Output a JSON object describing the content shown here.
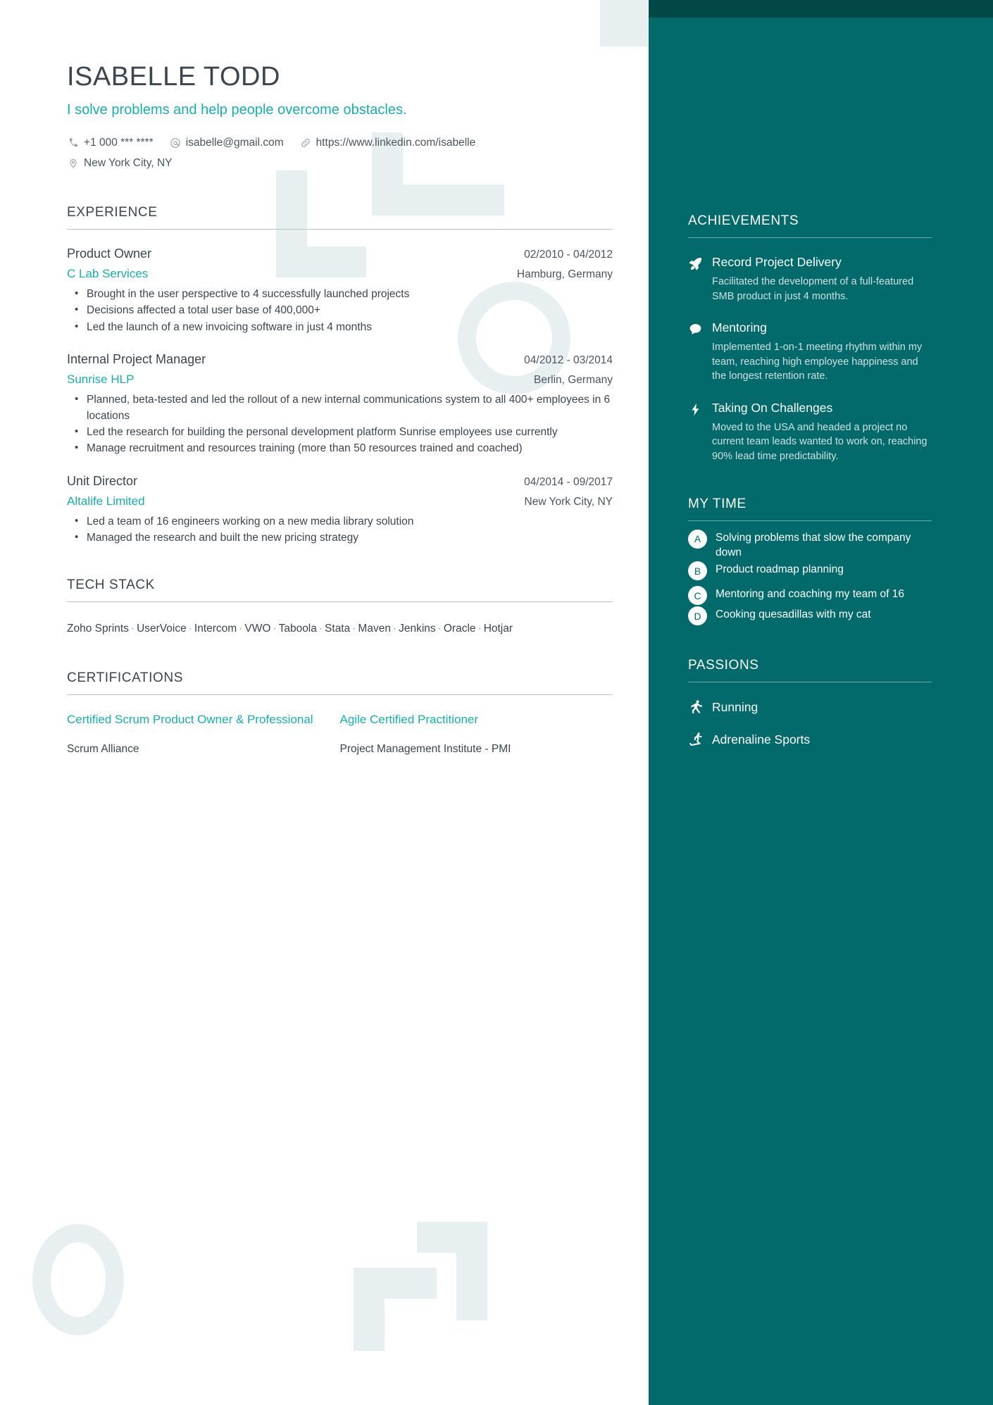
{
  "colors": {
    "accent_teal": "#16b0b0",
    "sidebar_bg": "#026a6a",
    "sidebar_band": "#014847",
    "text_dark": "#3b4650",
    "decoration": "#e8eff1"
  },
  "header": {
    "name": "ISABELLE TODD",
    "tagline": "I solve problems and help people overcome obstacles.",
    "contacts": [
      {
        "icon": "phone-icon",
        "value": "+1 000 *** ****"
      },
      {
        "icon": "email-icon",
        "value": "isabelle@gmail.com"
      },
      {
        "icon": "link-icon",
        "value": "https://www.linkedin.com/isabelle"
      },
      {
        "icon": "location-pin-icon",
        "value": "New York City, NY"
      }
    ]
  },
  "experience": {
    "title": "EXPERIENCE",
    "jobs": [
      {
        "role": "Product Owner",
        "date": "02/2010 - 04/2012",
        "company": "C Lab Services",
        "location": "Hamburg, Germany",
        "bullets": [
          "Brought in the user perspective to 4 successfully launched projects",
          "Decisions affected a total user base of 400,000+",
          "Led the launch of a new invoicing software in just 4 months"
        ]
      },
      {
        "role": "Internal Project Manager",
        "date": "04/2012 - 03/2014",
        "company": "Sunrise HLP",
        "location": "Berlin, Germany",
        "bullets": [
          "Planned, beta-tested and led the rollout of a new internal communications system to all 400+ employees in 6 locations",
          "Led the research for building the personal development platform Sunrise employees use currently",
          "Manage recruitment and resources training (more than 50 resources trained and coached)"
        ]
      },
      {
        "role": "Unit Director",
        "date": "04/2014 - 09/2017",
        "company": "Altalife Limited",
        "location": "New York City, NY",
        "bullets": [
          "Led a team of 16 engineers working on a new media library solution",
          "Managed the research and built the new pricing strategy"
        ]
      }
    ]
  },
  "tech_stack": {
    "title": "TECH STACK",
    "items": [
      "Zoho Sprints",
      "UserVoice",
      "Intercom",
      "VWO",
      "Taboola",
      "Stata",
      "Maven",
      "Jenkins",
      "Oracle",
      "Hotjar"
    ]
  },
  "certifications": {
    "title": "CERTIFICATIONS",
    "items": [
      {
        "name": "Certified Scrum Product Owner & Professional",
        "org": "Scrum Alliance"
      },
      {
        "name": "Agile Certified Practitioner",
        "org": "Project Management Institute - PMI"
      }
    ]
  },
  "achievements": {
    "title": "ACHIEVEMENTS",
    "items": [
      {
        "icon": "rocket-icon",
        "title": "Record Project Delivery",
        "desc": "Facilitated the development of a full-featured SMB product in just 4 months."
      },
      {
        "icon": "speech-bubble-icon",
        "title": "Mentoring",
        "desc": "Implemented 1-on-1 meeting rhythm within my team, reaching high employee happiness and the longest retention rate."
      },
      {
        "icon": "lightning-bolt-icon",
        "title": "Taking On Challenges",
        "desc": "Moved to the USA and headed a project no current team leads wanted to work on, reaching 90% lead time predictability."
      }
    ]
  },
  "my_time": {
    "title": "MY TIME",
    "items": [
      {
        "badge": "A",
        "text": "Solving problems that slow the company down"
      },
      {
        "badge": "B",
        "text": "Product roadmap planning"
      },
      {
        "badge": "C",
        "text": "Mentoring and coaching my team of 16"
      },
      {
        "badge": "D",
        "text": "Cooking quesadillas with my cat"
      }
    ]
  },
  "passions": {
    "title": "PASSIONS",
    "items": [
      {
        "icon": "running-icon",
        "label": "Running"
      },
      {
        "icon": "skateboard-icon",
        "label": "Adrenaline Sports"
      }
    ]
  }
}
